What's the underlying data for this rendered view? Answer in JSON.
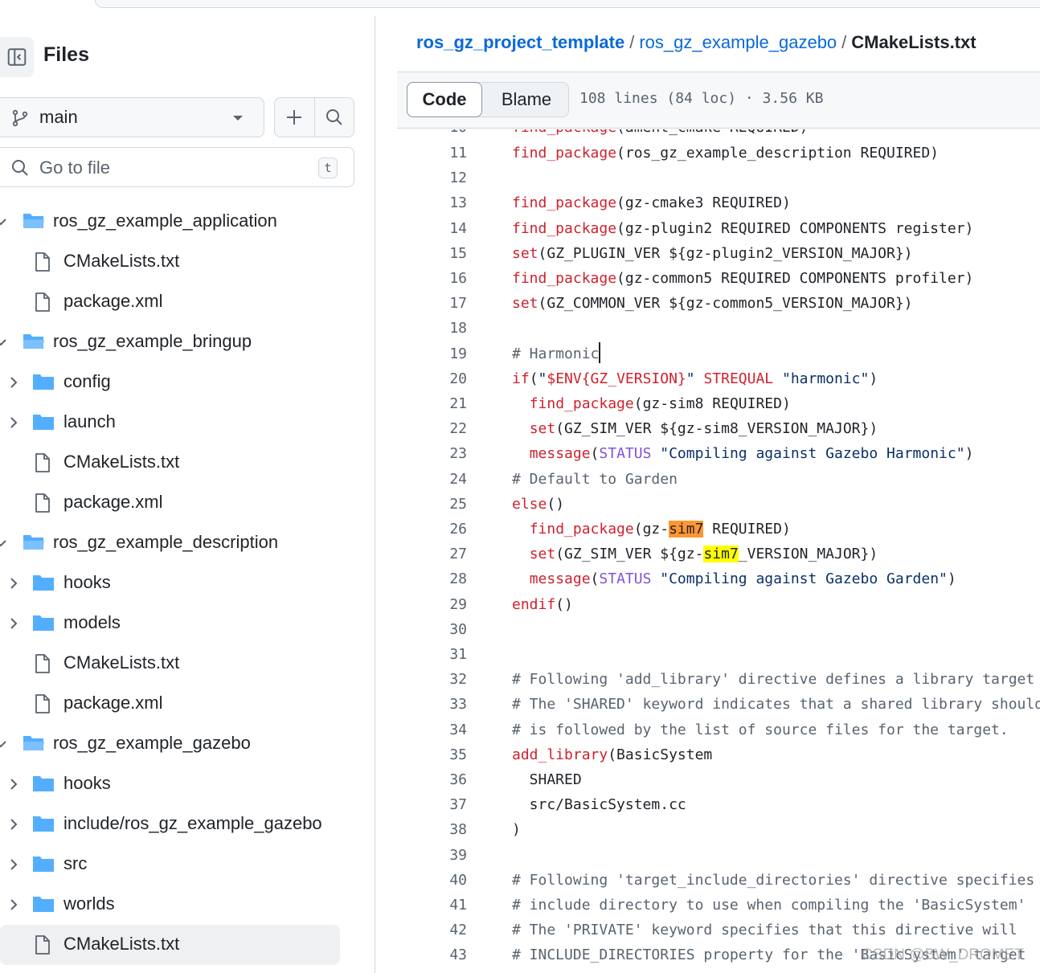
{
  "sidebar": {
    "title": "Files",
    "branch": "main",
    "goto_placeholder": "Go to file",
    "goto_shortcut": "t",
    "tree": [
      {
        "label": "ros_gz_example_application",
        "type": "folder-open",
        "depth": 0,
        "expanded": true
      },
      {
        "label": "CMakeLists.txt",
        "type": "file",
        "depth": 1
      },
      {
        "label": "package.xml",
        "type": "file",
        "depth": 1
      },
      {
        "label": "ros_gz_example_bringup",
        "type": "folder-open",
        "depth": 0,
        "expanded": true
      },
      {
        "label": "config",
        "type": "folder",
        "depth": 1
      },
      {
        "label": "launch",
        "type": "folder",
        "depth": 1
      },
      {
        "label": "CMakeLists.txt",
        "type": "file",
        "depth": 1
      },
      {
        "label": "package.xml",
        "type": "file",
        "depth": 1
      },
      {
        "label": "ros_gz_example_description",
        "type": "folder-open",
        "depth": 0,
        "expanded": true
      },
      {
        "label": "hooks",
        "type": "folder",
        "depth": 1
      },
      {
        "label": "models",
        "type": "folder",
        "depth": 1
      },
      {
        "label": "CMakeLists.txt",
        "type": "file",
        "depth": 1
      },
      {
        "label": "package.xml",
        "type": "file",
        "depth": 1
      },
      {
        "label": "ros_gz_example_gazebo",
        "type": "folder-open",
        "depth": 0,
        "expanded": true
      },
      {
        "label": "hooks",
        "type": "folder",
        "depth": 1
      },
      {
        "label": "include/ros_gz_example_gazebo",
        "type": "folder",
        "depth": 1
      },
      {
        "label": "src",
        "type": "folder",
        "depth": 1
      },
      {
        "label": "worlds",
        "type": "folder",
        "depth": 1
      },
      {
        "label": "CMakeLists.txt",
        "type": "file",
        "depth": 1,
        "selected": true
      }
    ]
  },
  "breadcrumb": {
    "repo": "ros_gz_project_template",
    "folder": "ros_gz_example_gazebo",
    "file": "CMakeLists.txt",
    "separator": "/"
  },
  "file_header": {
    "tab_code": "Code",
    "tab_blame": "Blame",
    "info": "108 lines (84 loc) · 3.56 KB"
  },
  "code": {
    "partial_line": {
      "n": "10",
      "text": "find_package(ament_cmake REQUIRED)"
    },
    "lines": [
      {
        "n": "11",
        "tokens": [
          [
            "k",
            "find_package"
          ],
          [
            "",
            "(ros_gz_example_description REQUIRED)"
          ]
        ]
      },
      {
        "n": "12",
        "tokens": []
      },
      {
        "n": "13",
        "tokens": [
          [
            "k",
            "find_package"
          ],
          [
            "",
            "(gz-cmake3 REQUIRED)"
          ]
        ]
      },
      {
        "n": "14",
        "tokens": [
          [
            "k",
            "find_package"
          ],
          [
            "",
            "(gz-plugin2 REQUIRED COMPONENTS register)"
          ]
        ]
      },
      {
        "n": "15",
        "tokens": [
          [
            "k",
            "set"
          ],
          [
            "",
            "(GZ_PLUGIN_VER ${gz-plugin2_VERSION_MAJOR})"
          ]
        ]
      },
      {
        "n": "16",
        "tokens": [
          [
            "k",
            "find_package"
          ],
          [
            "",
            "(gz-common5 REQUIRED COMPONENTS profiler)"
          ]
        ]
      },
      {
        "n": "17",
        "tokens": [
          [
            "k",
            "set"
          ],
          [
            "",
            "(GZ_COMMON_VER ${gz-common5_VERSION_MAJOR})"
          ]
        ]
      },
      {
        "n": "18",
        "tokens": []
      },
      {
        "n": "19",
        "tokens": [
          [
            "c",
            "# Harmonic"
          ],
          [
            "cursor",
            ""
          ]
        ]
      },
      {
        "n": "20",
        "tokens": [
          [
            "k",
            "if"
          ],
          [
            "",
            "("
          ],
          [
            "s",
            "\""
          ],
          [
            "k",
            "$ENV{GZ_VERSION}"
          ],
          [
            "s",
            "\""
          ],
          [
            "",
            ""
          ],
          [
            "k",
            " STREQUAL "
          ],
          [
            "s",
            "\"harmonic\""
          ],
          [
            "",
            ")"
          ]
        ]
      },
      {
        "n": "21",
        "tokens": [
          [
            "",
            "  "
          ],
          [
            "k",
            "find_package"
          ],
          [
            "",
            "(gz-sim8 REQUIRED)"
          ]
        ]
      },
      {
        "n": "22",
        "tokens": [
          [
            "",
            "  "
          ],
          [
            "k",
            "set"
          ],
          [
            "",
            "(GZ_SIM_VER ${gz-sim8_VERSION_MAJOR})"
          ]
        ]
      },
      {
        "n": "23",
        "tokens": [
          [
            "",
            "  "
          ],
          [
            "k",
            "message"
          ],
          [
            "",
            "("
          ],
          [
            "v",
            "STATUS"
          ],
          [
            "s",
            " \"Compiling against Gazebo Harmonic\""
          ],
          [
            "",
            ")"
          ]
        ]
      },
      {
        "n": "24",
        "tokens": [
          [
            "c",
            "# Default to Garden"
          ]
        ]
      },
      {
        "n": "25",
        "tokens": [
          [
            "k",
            "else"
          ],
          [
            "",
            "()"
          ]
        ]
      },
      {
        "n": "26",
        "tokens": [
          [
            "",
            "  "
          ],
          [
            "k",
            "find_package"
          ],
          [
            "",
            "(gz-"
          ],
          [
            "hl1",
            "sim7"
          ],
          [
            "",
            " REQUIRED)"
          ]
        ]
      },
      {
        "n": "27",
        "tokens": [
          [
            "",
            "  "
          ],
          [
            "k",
            "set"
          ],
          [
            "",
            "(GZ_SIM_VER ${gz-"
          ],
          [
            "hl2",
            "sim7"
          ],
          [
            "",
            "_VERSION_MAJOR})"
          ]
        ]
      },
      {
        "n": "28",
        "tokens": [
          [
            "",
            "  "
          ],
          [
            "k",
            "message"
          ],
          [
            "",
            "("
          ],
          [
            "v",
            "STATUS"
          ],
          [
            "s",
            " \"Compiling against Gazebo Garden\""
          ],
          [
            "",
            ")"
          ]
        ]
      },
      {
        "n": "29",
        "tokens": [
          [
            "k",
            "endif"
          ],
          [
            "",
            "()"
          ]
        ]
      },
      {
        "n": "30",
        "tokens": []
      },
      {
        "n": "31",
        "tokens": []
      },
      {
        "n": "32",
        "tokens": [
          [
            "c",
            "# Following 'add_library' directive defines a library target"
          ]
        ]
      },
      {
        "n": "33",
        "tokens": [
          [
            "c",
            "# The 'SHARED' keyword indicates that a shared library should"
          ]
        ]
      },
      {
        "n": "34",
        "tokens": [
          [
            "c",
            "# is followed by the list of source files for the target."
          ]
        ]
      },
      {
        "n": "35",
        "tokens": [
          [
            "k",
            "add_library"
          ],
          [
            "",
            "(BasicSystem"
          ]
        ]
      },
      {
        "n": "36",
        "tokens": [
          [
            "",
            "  SHARED"
          ]
        ]
      },
      {
        "n": "37",
        "tokens": [
          [
            "",
            "  src/BasicSystem.cc"
          ]
        ]
      },
      {
        "n": "38",
        "tokens": [
          [
            "",
            ")"
          ]
        ]
      },
      {
        "n": "39",
        "tokens": []
      },
      {
        "n": "40",
        "tokens": [
          [
            "c",
            "# Following 'target_include_directories' directive specifies"
          ]
        ]
      },
      {
        "n": "41",
        "tokens": [
          [
            "c",
            "# include directory to use when compiling the 'BasicSystem'"
          ]
        ]
      },
      {
        "n": "42",
        "tokens": [
          [
            "c",
            "# The 'PRIVATE' keyword specifies that this directive will"
          ]
        ]
      },
      {
        "n": "43",
        "tokens": [
          [
            "c",
            "# INCLUDE_DIRECTORIES property for the 'BasicSystem' target"
          ]
        ]
      }
    ]
  },
  "watermark": "CSDN @BW_DROMET",
  "colors": {
    "link": "#0969da",
    "keyword": "#cf222e",
    "string": "#0a3069",
    "variable": "#8250df",
    "comment": "#59636e",
    "folder": "#54aeff",
    "highlight_current": "#ff9632",
    "highlight_match": "#ffff00"
  }
}
